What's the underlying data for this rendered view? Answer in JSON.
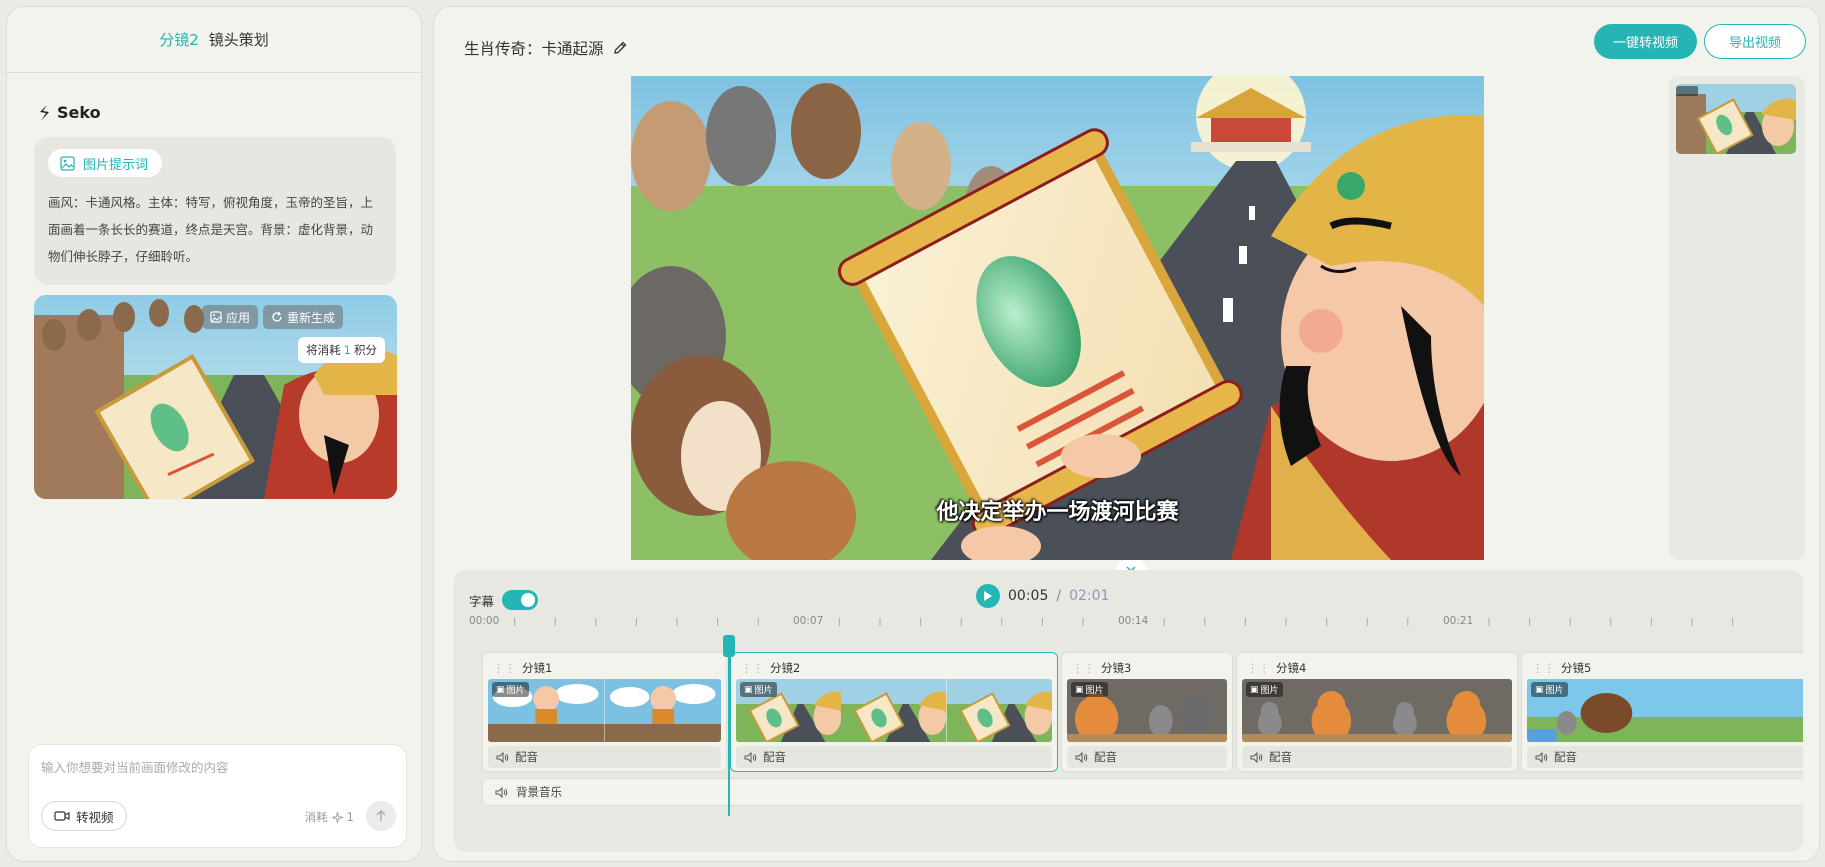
{
  "left": {
    "header_active": "分镜2",
    "header_title": "镜头策划",
    "brand": "Seko",
    "prompt_chip": "图片提示词",
    "prompt_text": "画风：卡通风格。主体：特写，俯视角度，玉帝的圣旨，上面画着一条长长的赛道，终点是天宫。背景：虚化背景，动物们伸长脖子，仔细聆听。",
    "apply_label": "应用",
    "regen_label": "重新生成",
    "tip_prefix": "将消耗",
    "tip_num": "1",
    "tip_suffix": "积分",
    "input_placeholder": "输入你想要对当前画面修改的内容",
    "to_video_label": "转视频",
    "consume_label": "消耗",
    "consume_num": "1"
  },
  "main": {
    "project_title": "生肖传奇：卡通起源",
    "primary_btn": "一键转视频",
    "export_btn": "导出视频",
    "subtitle_text": "他决定举办一场渡河比赛"
  },
  "timeline": {
    "subtitle_toggle": "字幕",
    "subtitle_on": true,
    "current_time": "00:05",
    "separator": "/",
    "total_time": "02:01",
    "ruler_labels": [
      "00:00",
      "00:07",
      "00:14",
      "00:21"
    ],
    "badge": "图片",
    "dub_label": "配音",
    "bgm_label": "背景音乐",
    "clips": [
      {
        "label": "分镜1"
      },
      {
        "label": "分镜2"
      },
      {
        "label": "分镜3"
      },
      {
        "label": "分镜4"
      },
      {
        "label": "分镜5"
      }
    ]
  },
  "colors": {
    "accent": "#25b5b5",
    "total_time": "#9f8fbf"
  }
}
